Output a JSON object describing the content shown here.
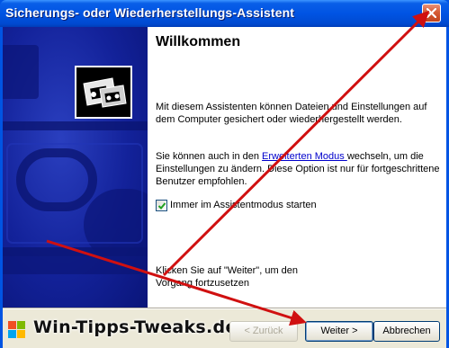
{
  "window": {
    "title": "Sicherungs- oder Wiederherstellungs-Assistent"
  },
  "content": {
    "heading": "Willkommen",
    "para1": "Mit diesem Assistenten können Dateien und Einstellungen auf dem Computer gesichert oder wiederhergestellt werden.",
    "para2_before": "Sie können auch in den ",
    "advanced_link": "Erweiterten Modus ",
    "para2_after": "wechseln, um die Einstellungen zu ändern. Diese Option ist nur für fortgeschrittene Benutzer empfohlen.",
    "checkbox_label": "Immer im Assistentmodus starten",
    "checkbox_checked": true,
    "para3": "Klicken Sie auf \"Weiter\", um den Vorgang fortzusetzen"
  },
  "footer": {
    "brand": "Win-Tipps-Tweaks.de",
    "back_label": "< Zurück",
    "next_label": "Weiter >",
    "cancel_label": "Abbrechen"
  },
  "icons": {
    "close": "close-icon",
    "wizard": "backup-tape-icon",
    "windows_logo": "windows-flag-icon",
    "check": "check-icon"
  },
  "colors": {
    "titlebar": "#0054e3",
    "banner": "#13229a",
    "link": "#0000cc",
    "arrow": "#d01010"
  }
}
